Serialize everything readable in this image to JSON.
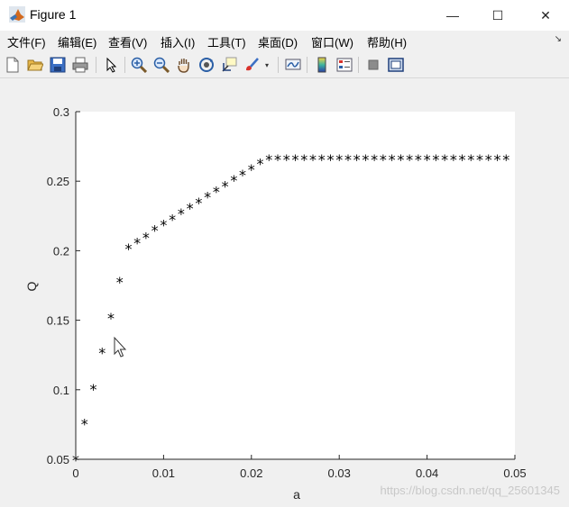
{
  "window": {
    "title": "Figure 1",
    "controls": {
      "minimize": "—",
      "maximize": "☐",
      "close": "✕"
    }
  },
  "menubar": {
    "items": [
      {
        "label": "文件(F)"
      },
      {
        "label": "编辑(E)"
      },
      {
        "label": "查看(V)"
      },
      {
        "label": "插入(I)"
      },
      {
        "label": "工具(T)"
      },
      {
        "label": "桌面(D)"
      },
      {
        "label": "窗口(W)"
      },
      {
        "label": "帮助(H)"
      }
    ]
  },
  "toolbar": {
    "buttons": [
      "new-figure-icon",
      "open-file-icon",
      "save-icon",
      "print-icon",
      "edit-plot-arrow-icon",
      "zoom-in-icon",
      "zoom-out-icon",
      "pan-hand-icon",
      "rotate-3d-icon",
      "data-cursor-icon",
      "brush-icon",
      "link-plot-icon",
      "colorbar-icon",
      "legend-icon",
      "hide-plot-tools-icon",
      "show-plot-tools-icon"
    ]
  },
  "chart_data": {
    "type": "scatter",
    "marker": "*",
    "marker_color": "#000000",
    "xlabel": "a",
    "ylabel": "Q",
    "xlim": [
      0,
      0.05
    ],
    "ylim": [
      0.05,
      0.3
    ],
    "xticks": [
      "0",
      "0.01",
      "0.02",
      "0.03",
      "0.04",
      "0.05"
    ],
    "yticks": [
      "0.05",
      "0.1",
      "0.15",
      "0.2",
      "0.25",
      "0.3"
    ],
    "grid": false,
    "series": [
      {
        "x": [
          0.0,
          0.001,
          0.002,
          0.003,
          0.004,
          0.005,
          0.006,
          0.007,
          0.008,
          0.009,
          0.01,
          0.011,
          0.012,
          0.013,
          0.014,
          0.015,
          0.016,
          0.017,
          0.018,
          0.019,
          0.02,
          0.021,
          0.022,
          0.023,
          0.024,
          0.025,
          0.026,
          0.027,
          0.028,
          0.029,
          0.03,
          0.031,
          0.032,
          0.033,
          0.034,
          0.035,
          0.036,
          0.037,
          0.038,
          0.039,
          0.04,
          0.041,
          0.042,
          0.043,
          0.044,
          0.045,
          0.046,
          0.047,
          0.048,
          0.049
        ],
        "y": [
          0.05,
          0.076,
          0.101,
          0.127,
          0.152,
          0.178,
          0.202,
          0.206,
          0.21,
          0.215,
          0.219,
          0.223,
          0.227,
          0.231,
          0.235,
          0.239,
          0.243,
          0.247,
          0.251,
          0.255,
          0.259,
          0.263,
          0.266,
          0.266,
          0.266,
          0.266,
          0.266,
          0.266,
          0.266,
          0.266,
          0.266,
          0.266,
          0.266,
          0.266,
          0.266,
          0.266,
          0.266,
          0.266,
          0.266,
          0.266,
          0.266,
          0.266,
          0.266,
          0.266,
          0.266,
          0.266,
          0.266,
          0.266,
          0.266,
          0.266
        ]
      }
    ]
  },
  "watermark": "https://blog.csdn.net/qq_25601345"
}
